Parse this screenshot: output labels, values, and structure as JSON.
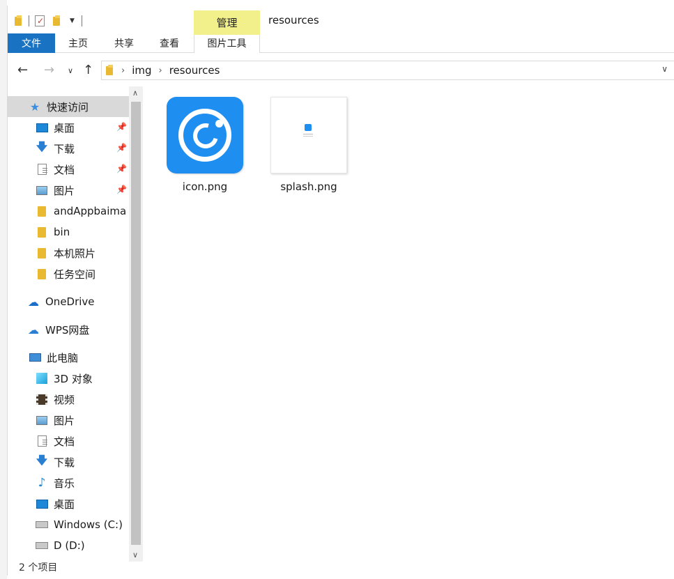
{
  "titlebar": {
    "manage_label": "管理",
    "title": "resources"
  },
  "ribbon": {
    "tabs": [
      {
        "label": "文件"
      },
      {
        "label": "主页"
      },
      {
        "label": "共享"
      },
      {
        "label": "查看"
      },
      {
        "label": "图片工具"
      }
    ]
  },
  "address": {
    "crumbs": [
      "img",
      "resources"
    ]
  },
  "nav": {
    "items": [
      {
        "label": "快速访问",
        "icon": "star-icon"
      },
      {
        "label": "桌面",
        "icon": "desktop-icon",
        "pinned": true
      },
      {
        "label": "下载",
        "icon": "download-icon",
        "pinned": true
      },
      {
        "label": "文档",
        "icon": "document-icon",
        "pinned": true
      },
      {
        "label": "图片",
        "icon": "pictures-icon",
        "pinned": true
      },
      {
        "label": "andAppbaima",
        "icon": "folder-icon"
      },
      {
        "label": "bin",
        "icon": "folder-icon"
      },
      {
        "label": "本机照片",
        "icon": "folder-icon"
      },
      {
        "label": "任务空间",
        "icon": "folder-icon"
      },
      {
        "label": "OneDrive",
        "icon": "cloud-icon"
      },
      {
        "label": "WPS网盘",
        "icon": "wps-cloud-icon"
      },
      {
        "label": "此电脑",
        "icon": "computer-icon"
      },
      {
        "label": "3D 对象",
        "icon": "3d-objects-icon"
      },
      {
        "label": "视频",
        "icon": "video-icon"
      },
      {
        "label": "图片",
        "icon": "pictures-icon"
      },
      {
        "label": "文档",
        "icon": "document-icon"
      },
      {
        "label": "下载",
        "icon": "download-icon"
      },
      {
        "label": "音乐",
        "icon": "music-icon"
      },
      {
        "label": "桌面",
        "icon": "desktop-icon"
      },
      {
        "label": "Windows (C:)",
        "icon": "drive-icon"
      },
      {
        "label": "D (D:)",
        "icon": "drive-icon"
      }
    ]
  },
  "files": [
    {
      "name": "icon.png"
    },
    {
      "name": "splash.png"
    }
  ],
  "status": {
    "count_text": "2 个项目"
  },
  "colors": {
    "file_tab": "#1a73c2",
    "manage_tab": "#f2f08a",
    "selected_nav": "#d9d9d9",
    "app_icon_blue": "#1f8ef1"
  }
}
